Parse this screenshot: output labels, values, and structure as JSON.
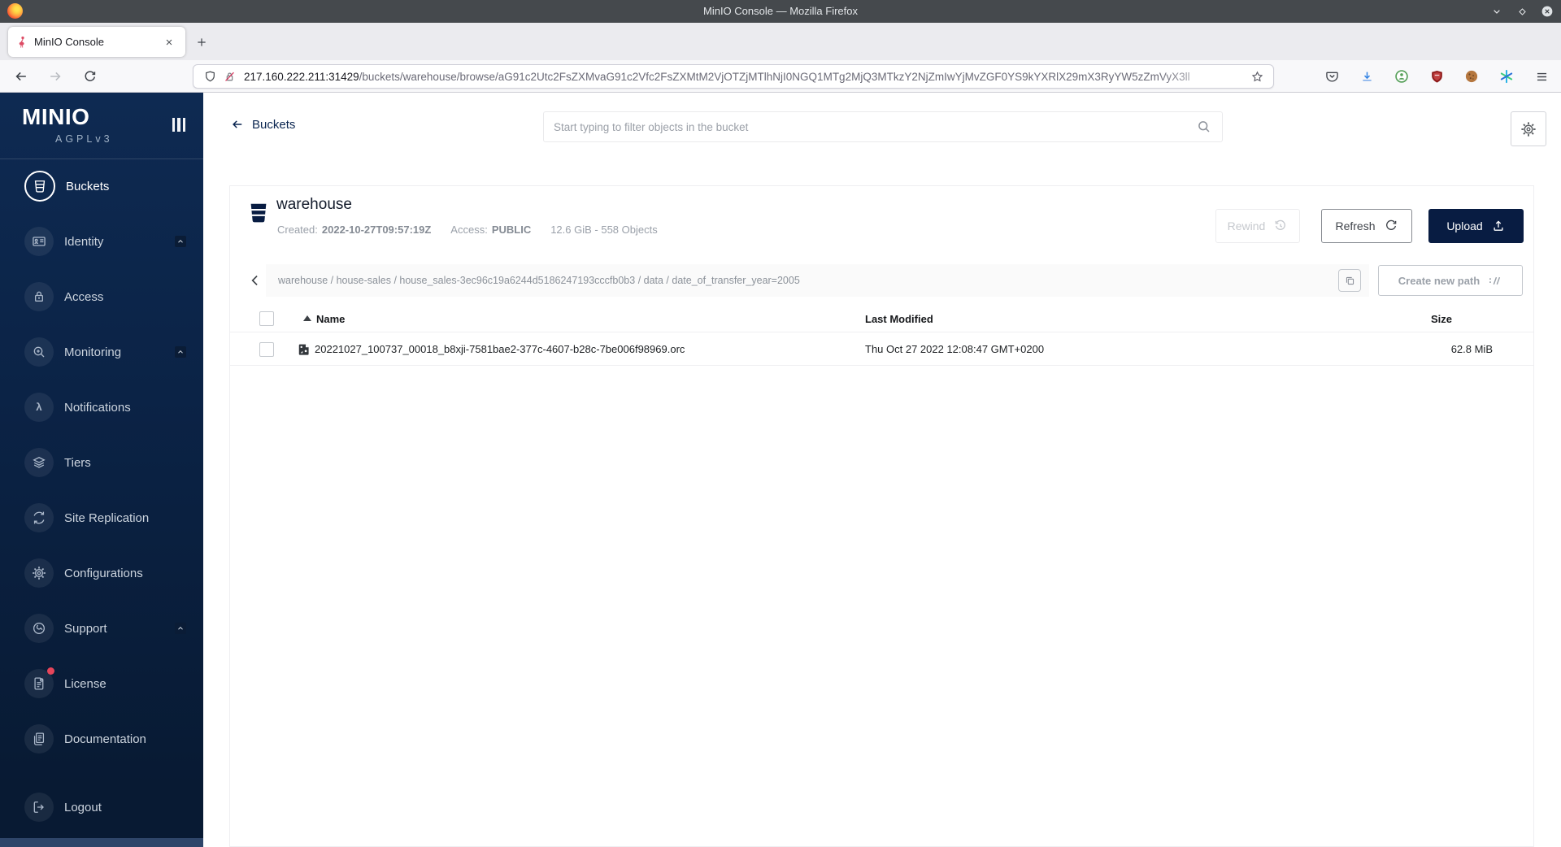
{
  "window": {
    "title": "MinIO Console — Mozilla Firefox"
  },
  "browser": {
    "tab_title": "MinIO Console",
    "url": {
      "host": "217.160.222.211:31429",
      "path": "/buckets/warehouse/browse/aG91c2Utc2FsZXMvaG91c2Vfc2FsZXMtM2VjOTZjMTlhNjI0NGQ1MTg2MjQ3MTkzY2NjZmIwYjMvZGF0YS9kYXRlX29mX3RyYW5zZmVyX3ll"
    }
  },
  "sidebar": {
    "brand": "MINIO",
    "license_tag": "AGPLv3",
    "items": [
      {
        "label": "Buckets"
      },
      {
        "label": "Identity"
      },
      {
        "label": "Access"
      },
      {
        "label": "Monitoring"
      },
      {
        "label": "Notifications"
      },
      {
        "label": "Tiers"
      },
      {
        "label": "Site Replication"
      },
      {
        "label": "Configurations"
      },
      {
        "label": "Support"
      },
      {
        "label": "License"
      },
      {
        "label": "Documentation"
      },
      {
        "label": "Logout"
      }
    ]
  },
  "header": {
    "back_label": "Buckets",
    "search_placeholder": "Start typing to filter objects in the bucket"
  },
  "bucket": {
    "name": "warehouse",
    "created_label": "Created:",
    "created_value": "2022-10-27T09:57:19Z",
    "access_label": "Access:",
    "access_value": "PUBLIC",
    "usage": "12.6 GiB - 558 Objects",
    "rewind_label": "Rewind",
    "refresh_label": "Refresh",
    "upload_label": "Upload"
  },
  "browse": {
    "path": "warehouse / house-sales / house_sales-3ec96c19a6244d5186247193cccfb0b3 / data / date_of_transfer_year=2005",
    "create_path_label": "Create new path"
  },
  "objects": {
    "columns": {
      "name": "Name",
      "modified": "Last Modified",
      "size": "Size"
    },
    "rows": [
      {
        "name": "20221027_100737_00018_b8xji-7581bae2-377c-4607-b28c-7be006f98969.orc",
        "modified": "Thu Oct 27 2022 12:08:47 GMT+0200",
        "size": "62.8 MiB"
      }
    ]
  },
  "colors": {
    "accent_navy": "#081C42",
    "sidebar_top": "#0e2a52",
    "sidebar_bottom": "#081a33",
    "badge_red": "#e6455a",
    "muted_gray": "#9ba0a8"
  }
}
